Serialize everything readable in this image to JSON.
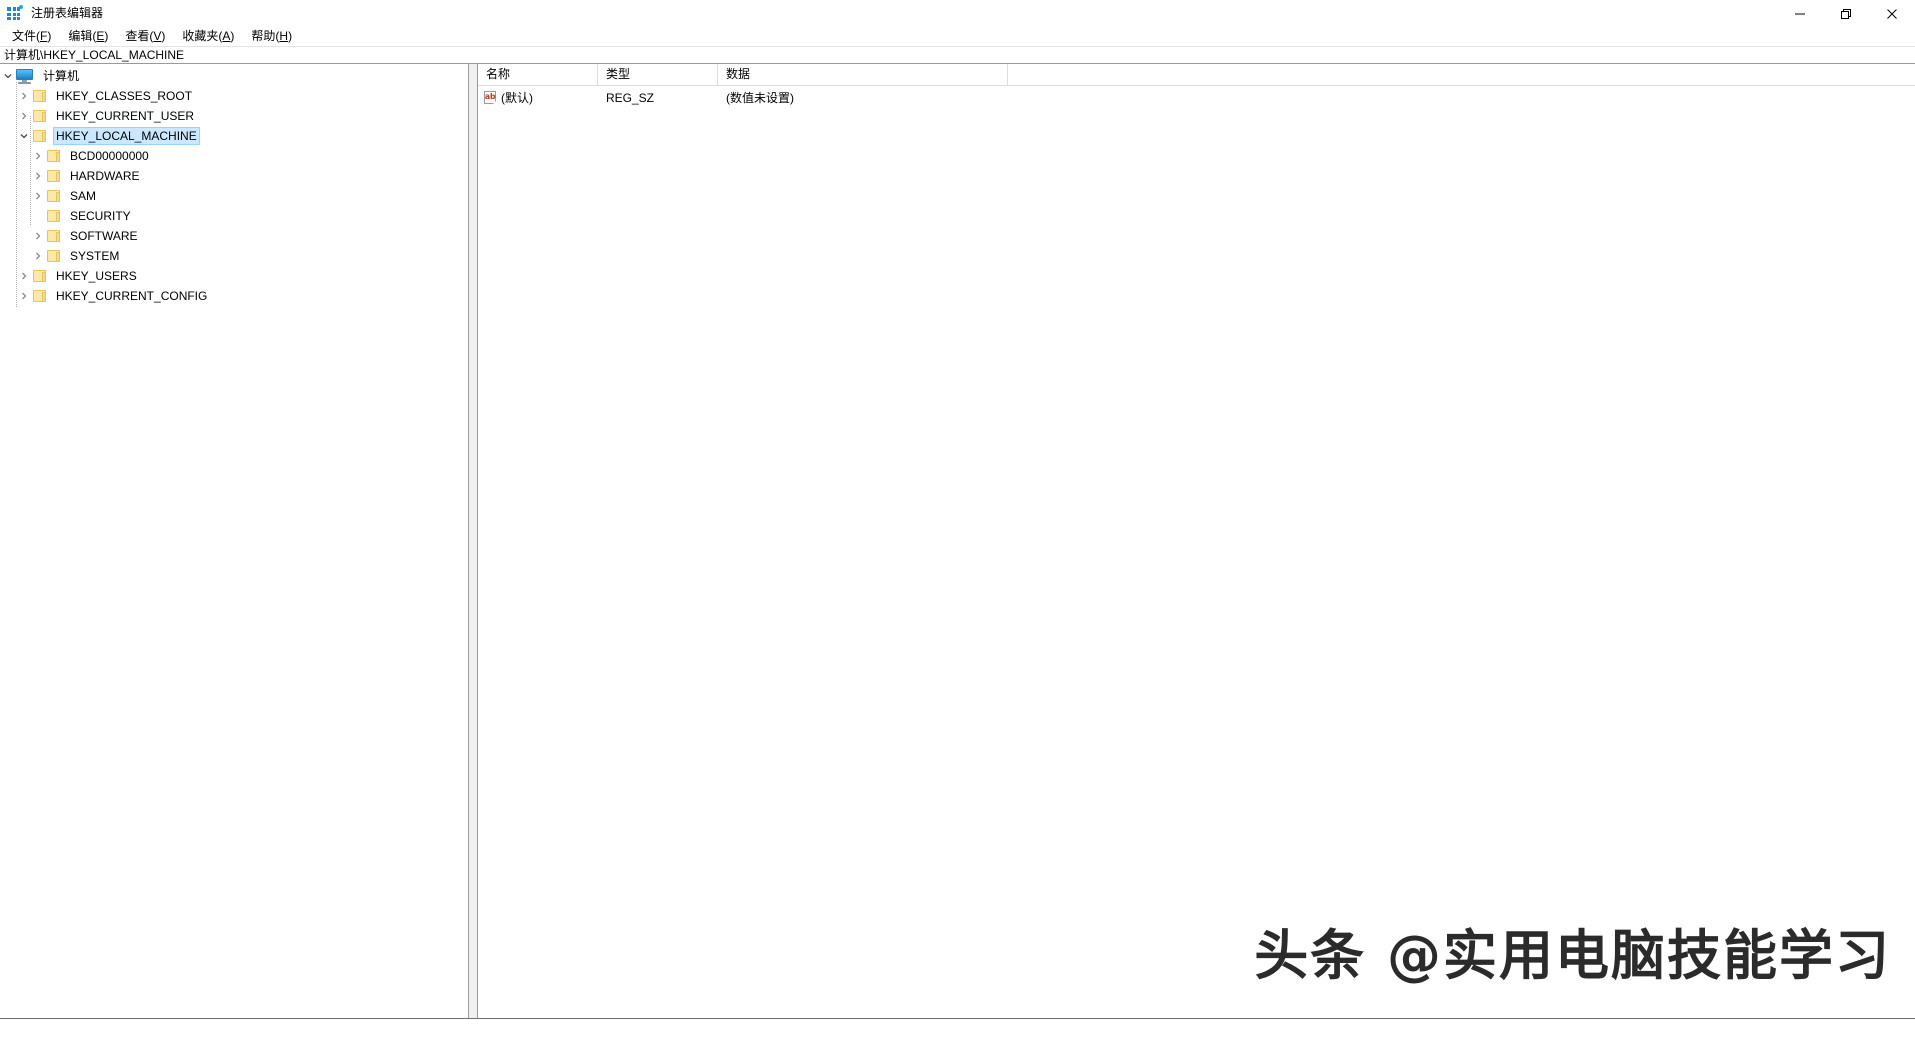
{
  "window": {
    "title": "注册表编辑器",
    "app_icon": "registry-grid-icon",
    "controls": {
      "minimize": "minimize-icon",
      "restore": "restore-icon",
      "close": "close-icon"
    }
  },
  "menubar": {
    "items": [
      {
        "label": "文件(F)",
        "text": "文件(",
        "accel": "F",
        "tail": ")"
      },
      {
        "label": "编辑(E)",
        "text": "编辑(",
        "accel": "E",
        "tail": ")"
      },
      {
        "label": "查看(V)",
        "text": "查看(",
        "accel": "V",
        "tail": ")"
      },
      {
        "label": "收藏夹(A)",
        "text": "收藏夹(",
        "accel": "A",
        "tail": ")"
      },
      {
        "label": "帮助(H)",
        "text": "帮助(",
        "accel": "H",
        "tail": ")"
      }
    ]
  },
  "addressbar": {
    "value": "计算机\\HKEY_LOCAL_MACHINE"
  },
  "tree": {
    "root": {
      "label": "计算机",
      "icon": "computer-icon",
      "expanded": true
    },
    "nodes": [
      {
        "label": "HKEY_CLASSES_ROOT",
        "level": 1,
        "expandable": true,
        "expanded": false,
        "selected": false,
        "icon": "folder-icon"
      },
      {
        "label": "HKEY_CURRENT_USER",
        "level": 1,
        "expandable": true,
        "expanded": false,
        "selected": false,
        "icon": "folder-icon"
      },
      {
        "label": "HKEY_LOCAL_MACHINE",
        "level": 1,
        "expandable": true,
        "expanded": true,
        "selected": true,
        "icon": "folder-icon"
      },
      {
        "label": "BCD00000000",
        "level": 2,
        "expandable": true,
        "expanded": false,
        "selected": false,
        "icon": "folder-icon"
      },
      {
        "label": "HARDWARE",
        "level": 2,
        "expandable": true,
        "expanded": false,
        "selected": false,
        "icon": "folder-icon"
      },
      {
        "label": "SAM",
        "level": 2,
        "expandable": true,
        "expanded": false,
        "selected": false,
        "icon": "folder-icon"
      },
      {
        "label": "SECURITY",
        "level": 2,
        "expandable": false,
        "expanded": false,
        "selected": false,
        "icon": "folder-icon"
      },
      {
        "label": "SOFTWARE",
        "level": 2,
        "expandable": true,
        "expanded": false,
        "selected": false,
        "icon": "folder-icon"
      },
      {
        "label": "SYSTEM",
        "level": 2,
        "expandable": true,
        "expanded": false,
        "selected": false,
        "icon": "folder-icon"
      },
      {
        "label": "HKEY_USERS",
        "level": 1,
        "expandable": true,
        "expanded": false,
        "selected": false,
        "icon": "folder-icon"
      },
      {
        "label": "HKEY_CURRENT_CONFIG",
        "level": 1,
        "expandable": true,
        "expanded": false,
        "selected": false,
        "icon": "folder-icon"
      }
    ]
  },
  "list": {
    "columns": [
      {
        "label": "名称"
      },
      {
        "label": "类型"
      },
      {
        "label": "数据"
      }
    ],
    "rows": [
      {
        "icon": "string-value-ab-icon",
        "name": "(默认)",
        "type": "REG_SZ",
        "data": "(数值未设置)"
      }
    ]
  },
  "watermark": {
    "text": "头条 @实用电脑技能学习"
  },
  "colors": {
    "selection": "#cce8ff",
    "selection_border": "#99d1ff",
    "folder": "#fce9a8",
    "accent": "#1b8ad6"
  }
}
